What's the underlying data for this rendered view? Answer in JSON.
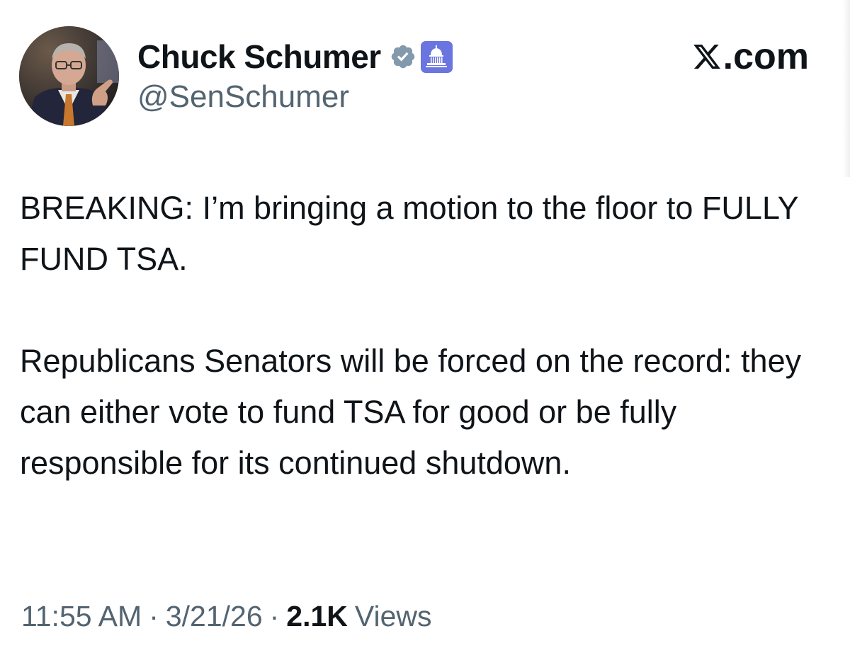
{
  "author": {
    "display_name": "Chuck Schumer",
    "handle": "@SenSchumer",
    "avatar_icon": "profile-photo",
    "verified_icon": "verified-badge-icon",
    "affiliation_icon": "us-capitol-icon",
    "verified_color": "#829aab",
    "affiliation_color": "#6a75e0"
  },
  "site": {
    "logo_icon": "x-logo-icon",
    "domain_suffix": ".com"
  },
  "tweet": {
    "paragraphs": [
      "BREAKING: I’m bringing a motion to the floor to FULLY FUND TSA.",
      "Republicans Senators will be forced on the record: they can either vote to fund TSA for good or be fully responsible for its continued shutdown."
    ]
  },
  "meta": {
    "time": "11:55 AM",
    "separator": "·",
    "date": "3/21/26",
    "views_count": "2.1K",
    "views_label": "Views"
  }
}
